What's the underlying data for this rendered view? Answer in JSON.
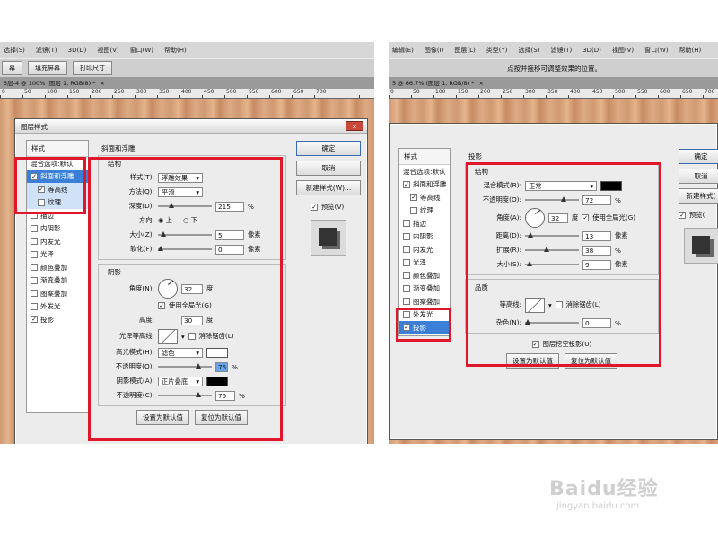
{
  "left": {
    "menu": [
      "选择(S)",
      "滤镜(T)",
      "3D(D)",
      "视图(V)",
      "窗口(W)",
      "帮助(H)"
    ],
    "options": [
      "幕",
      "填充屏幕",
      "打印尺寸"
    ],
    "doc_tab": "5层-4 @ 100% (图层 1, RGB/8) *",
    "ruler": [
      "0",
      "50",
      "100",
      "150",
      "200",
      "250",
      "300",
      "350",
      "400",
      "450",
      "500",
      "550",
      "600",
      "650",
      "700"
    ],
    "dialog_title": "图层样式",
    "styles_header": "样式",
    "blend_options": "混合选项:默认",
    "style_items": [
      {
        "label": "斜面和浮雕",
        "checked": true,
        "state": "sel"
      },
      {
        "label": "等高线",
        "checked": true,
        "state": "subsel",
        "sub": true
      },
      {
        "label": "纹理",
        "checked": false,
        "state": "subsel",
        "sub": true
      },
      {
        "label": "描边",
        "checked": false
      },
      {
        "label": "内阴影",
        "checked": false
      },
      {
        "label": "内发光",
        "checked": false
      },
      {
        "label": "光泽",
        "checked": false
      },
      {
        "label": "颜色叠加",
        "checked": false
      },
      {
        "label": "渐变叠加",
        "checked": false
      },
      {
        "label": "图案叠加",
        "checked": false
      },
      {
        "label": "外发光",
        "checked": false
      },
      {
        "label": "投影",
        "checked": true
      }
    ],
    "section_title": "斜面和浮雕",
    "structure_title": "结构",
    "style_label": "样式(T):",
    "style_value": "浮雕效果",
    "method_label": "方法(Q):",
    "method_value": "平滑",
    "depth_label": "深度(D):",
    "depth_value": "215",
    "depth_unit": "%",
    "depth_level": 0.22,
    "direction_label": "方向:",
    "dir_up": "上",
    "dir_down": "下",
    "size_label": "大小(Z):",
    "size_value": "5",
    "size_unit": "像素",
    "size_level": 0.05,
    "soften_label": "软化(F):",
    "soften_value": "0",
    "soften_unit": "像素",
    "soften_level": 0,
    "shading_title": "阴影",
    "angle_label": "角度(N):",
    "angle_value": "32",
    "angle_unit": "度",
    "global_light": "使用全局光(G)",
    "altitude_label": "高度:",
    "altitude_value": "30",
    "altitude_unit": "度",
    "gloss_label": "光泽等高线:",
    "antialias": "消除锯齿(L)",
    "highlight_mode_label": "高光模式(H):",
    "highlight_mode_value": "滤色",
    "highlight_color": "#ffffff",
    "highlight_opacity_label": "不透明度(O):",
    "highlight_opacity_value": "75",
    "highlight_opacity_level": 0.75,
    "shadow_mode_label": "阴影模式(A):",
    "shadow_mode_value": "正片叠底",
    "shadow_color": "#000000",
    "shadow_opacity_label": "不透明度(C):",
    "shadow_opacity_value": "75",
    "shadow_opacity_level": 0.75,
    "pct": "%",
    "make_default": "设置为默认值",
    "reset_default": "复位为默认值",
    "ok": "确定",
    "cancel": "取消",
    "new_style": "新建样式(W)...",
    "preview": "预览(V)"
  },
  "right": {
    "menu": [
      "编辑(E)",
      "图像(I)",
      "图层(L)",
      "类型(Y)",
      "选择(S)",
      "滤镜(T)",
      "3D(D)",
      "视图(V)",
      "窗口(W)",
      "帮助(H)"
    ],
    "hint": "点按并拖移可调整效果的位置。",
    "doc_tab": "5 @ 66.7% (图层 1, RGB/8) *",
    "ruler": [
      "0",
      "50",
      "100",
      "150",
      "200",
      "250",
      "300",
      "350",
      "400",
      "450",
      "500",
      "550",
      "600",
      "650",
      "700"
    ],
    "styles_header": "样式",
    "blend_options": "混合选项:默认",
    "style_items": [
      {
        "label": "斜面和浮雕",
        "checked": true
      },
      {
        "label": "等高线",
        "checked": true,
        "sub": true
      },
      {
        "label": "纹理",
        "checked": false,
        "sub": true
      },
      {
        "label": "描边",
        "checked": false
      },
      {
        "label": "内阴影",
        "checked": false
      },
      {
        "label": "内发光",
        "checked": false
      },
      {
        "label": "光泽",
        "checked": false
      },
      {
        "label": "颜色叠加",
        "checked": false
      },
      {
        "label": "渐变叠加",
        "checked": false
      },
      {
        "label": "图案叠加",
        "checked": false
      },
      {
        "label": "外发光",
        "checked": false
      },
      {
        "label": "投影",
        "checked": true,
        "state": "sel"
      }
    ],
    "section_title": "投影",
    "structure_title": "结构",
    "blend_mode_label": "混合模式(B):",
    "blend_mode_value": "正常",
    "shadow_color": "#000000",
    "opacity_label": "不透明度(O):",
    "opacity_value": "72",
    "opacity_level": 0.72,
    "angle_label": "角度(A):",
    "angle_value": "32",
    "angle_unit": "度",
    "global_light": "使用全局光(G)",
    "distance_label": "距离(D):",
    "distance_value": "13",
    "distance_level": 0.05,
    "spread_label": "扩展(R):",
    "spread_value": "38",
    "spread_level": 0.38,
    "size_label": "大小(S):",
    "size_value": "9",
    "size_level": 0.04,
    "px": "像素",
    "pct": "%",
    "quality_title": "品质",
    "contour_label": "等高线:",
    "antialias": "消除锯齿(L)",
    "noise_label": "杂色(N):",
    "noise_value": "0",
    "noise_level": 0,
    "knockout": "图层挖空投影(U)",
    "make_default": "设置为默认值",
    "reset_default": "复位为默认值",
    "ok": "确定",
    "cancel": "取消",
    "new_style": "新建样式(",
    "preview": "预览("
  },
  "watermark": {
    "brand": "Baidu经验",
    "url": "jingyan.baidu.com"
  },
  "colors": {
    "highlight_box": "#e0162b",
    "selection": "#3b7fd6"
  }
}
